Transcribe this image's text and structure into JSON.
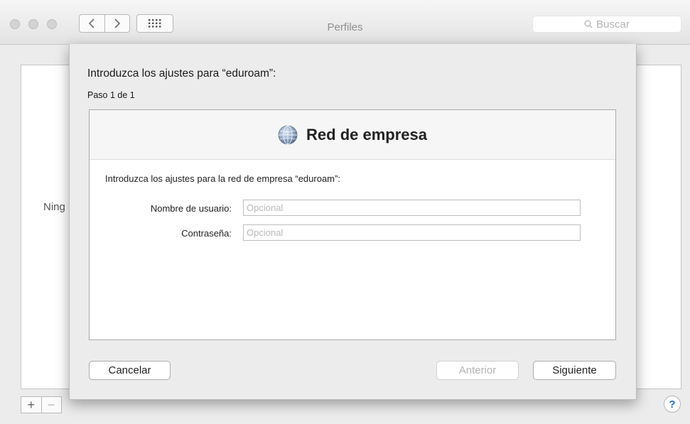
{
  "window": {
    "title": "Perfiles",
    "search_placeholder": "Buscar"
  },
  "background": {
    "empty_text": "Ning",
    "add_label": "+",
    "remove_label": "−",
    "help_label": "?"
  },
  "sheet": {
    "title": "Introduzca los ajustes para “eduroam”:",
    "step": "Paso 1 de 1",
    "section_title": "Red de empresa",
    "section_icon": "network-globe-icon",
    "description": "Introduzca los ajustes para la red de empresa “eduroam”:",
    "fields": {
      "username_label": "Nombre de usuario:",
      "username_placeholder": "Opcional",
      "username_value": "",
      "password_label": "Contraseña:",
      "password_placeholder": "Opcional",
      "password_value": ""
    },
    "buttons": {
      "cancel": "Cancelar",
      "previous": "Anterior",
      "next": "Siguiente"
    }
  },
  "colors": {
    "help_accent": "#1a6ee0",
    "globe_accent": "#3a7fd5"
  }
}
